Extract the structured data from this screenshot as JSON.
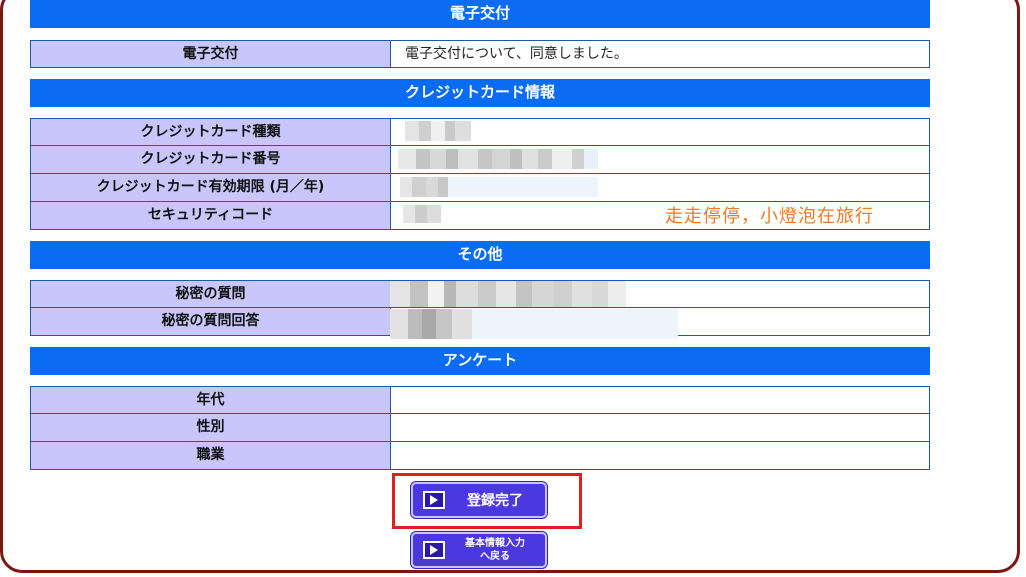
{
  "sections": {
    "electronic_delivery": {
      "header": "電子交付",
      "rows": [
        {
          "label": "電子交付",
          "value": "電子交付について、同意しました。"
        }
      ]
    },
    "credit_card": {
      "header": "クレジットカード情報",
      "rows": [
        {
          "label": "クレジットカード種類",
          "value": ""
        },
        {
          "label": "クレジットカード番号",
          "value": ""
        },
        {
          "label": "クレジットカード有効期限 (月／年)",
          "value": ""
        },
        {
          "label": "セキュリティコード",
          "value": ""
        }
      ]
    },
    "other": {
      "header": "その他",
      "rows": [
        {
          "label": "秘密の質問",
          "value": ""
        },
        {
          "label": "秘密の質問回答",
          "value": ""
        }
      ]
    },
    "survey": {
      "header": "アンケート",
      "rows": [
        {
          "label": "年代",
          "value": ""
        },
        {
          "label": "性別",
          "value": ""
        },
        {
          "label": "職業",
          "value": ""
        }
      ]
    }
  },
  "watermark": "走走停停，小燈泡在旅行",
  "buttons": {
    "complete": "登録完了",
    "back_line1": "基本情報入力",
    "back_line2": "へ戻る"
  },
  "colors": {
    "header_blue": "#0a6cf2",
    "label_lavender": "#c8c6fc",
    "button_purple": "#4b39e0",
    "frame_maroon": "#7d1515",
    "highlight_red": "#e02020"
  }
}
